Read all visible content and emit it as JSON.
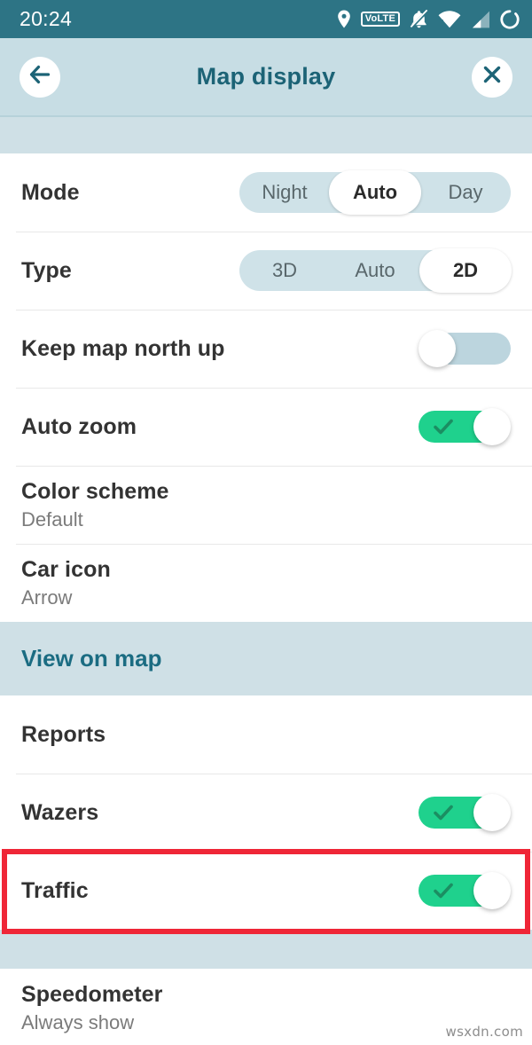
{
  "status_bar": {
    "time": "20:24",
    "icons": [
      {
        "name": "location-pin-icon",
        "label": "location"
      },
      {
        "name": "volte-icon",
        "label": "VoLTE"
      },
      {
        "name": "bell-muted-icon",
        "label": "notifications muted"
      },
      {
        "name": "wifi-icon",
        "label": "wifi"
      },
      {
        "name": "cellular-signal-icon",
        "label": "signal"
      },
      {
        "name": "battery-circle-icon",
        "label": "battery"
      }
    ],
    "volte_text": "VoLTE",
    "background_color": "#2d7485"
  },
  "app_bar": {
    "title": "Map display",
    "back_icon": "arrow-left-icon",
    "close_icon": "close-icon",
    "background_color": "#c7dde4",
    "title_color": "#1c6376"
  },
  "settings": {
    "rows": [
      {
        "id": "mode",
        "type": "segmented",
        "label": "Mode",
        "options": [
          "Night",
          "Auto",
          "Day"
        ],
        "selected_index": 1,
        "selected_value": "Auto"
      },
      {
        "id": "type",
        "type": "segmented",
        "label": "Type",
        "options": [
          "3D",
          "Auto",
          "2D"
        ],
        "selected_index": 2,
        "selected_value": "2D"
      },
      {
        "id": "keep-map-north-up",
        "type": "toggle",
        "label": "Keep map north up",
        "state": "off"
      },
      {
        "id": "auto-zoom",
        "type": "toggle",
        "label": "Auto zoom",
        "state": "on"
      },
      {
        "id": "color-scheme",
        "type": "value",
        "label": "Color scheme",
        "value": "Default"
      },
      {
        "id": "car-icon",
        "type": "value",
        "label": "Car icon",
        "value": "Arrow"
      }
    ]
  },
  "view_on_map": {
    "section_title": "View on map",
    "rows": [
      {
        "id": "reports",
        "type": "plain",
        "label": "Reports"
      },
      {
        "id": "wazers",
        "type": "toggle",
        "label": "Wazers",
        "state": "on"
      },
      {
        "id": "traffic",
        "type": "toggle",
        "label": "Traffic",
        "state": "on",
        "highlighted": true
      }
    ]
  },
  "bottom_section": {
    "rows": [
      {
        "id": "speedometer",
        "type": "value",
        "label": "Speedometer",
        "value": "Always show"
      }
    ]
  },
  "highlight": {
    "target": "traffic",
    "color": "#ef2637"
  },
  "watermark": {
    "text": "wsxdn.com"
  },
  "colors": {
    "accent_teal": "#1c6376",
    "status_bar": "#2d7485",
    "app_bar": "#c7dde4",
    "band": "#cfe0e6",
    "toggle_on": "#1fd18d",
    "toggle_off": "#bcd5de",
    "segment_track": "#cfe2e8",
    "highlight_red": "#ef2637"
  }
}
